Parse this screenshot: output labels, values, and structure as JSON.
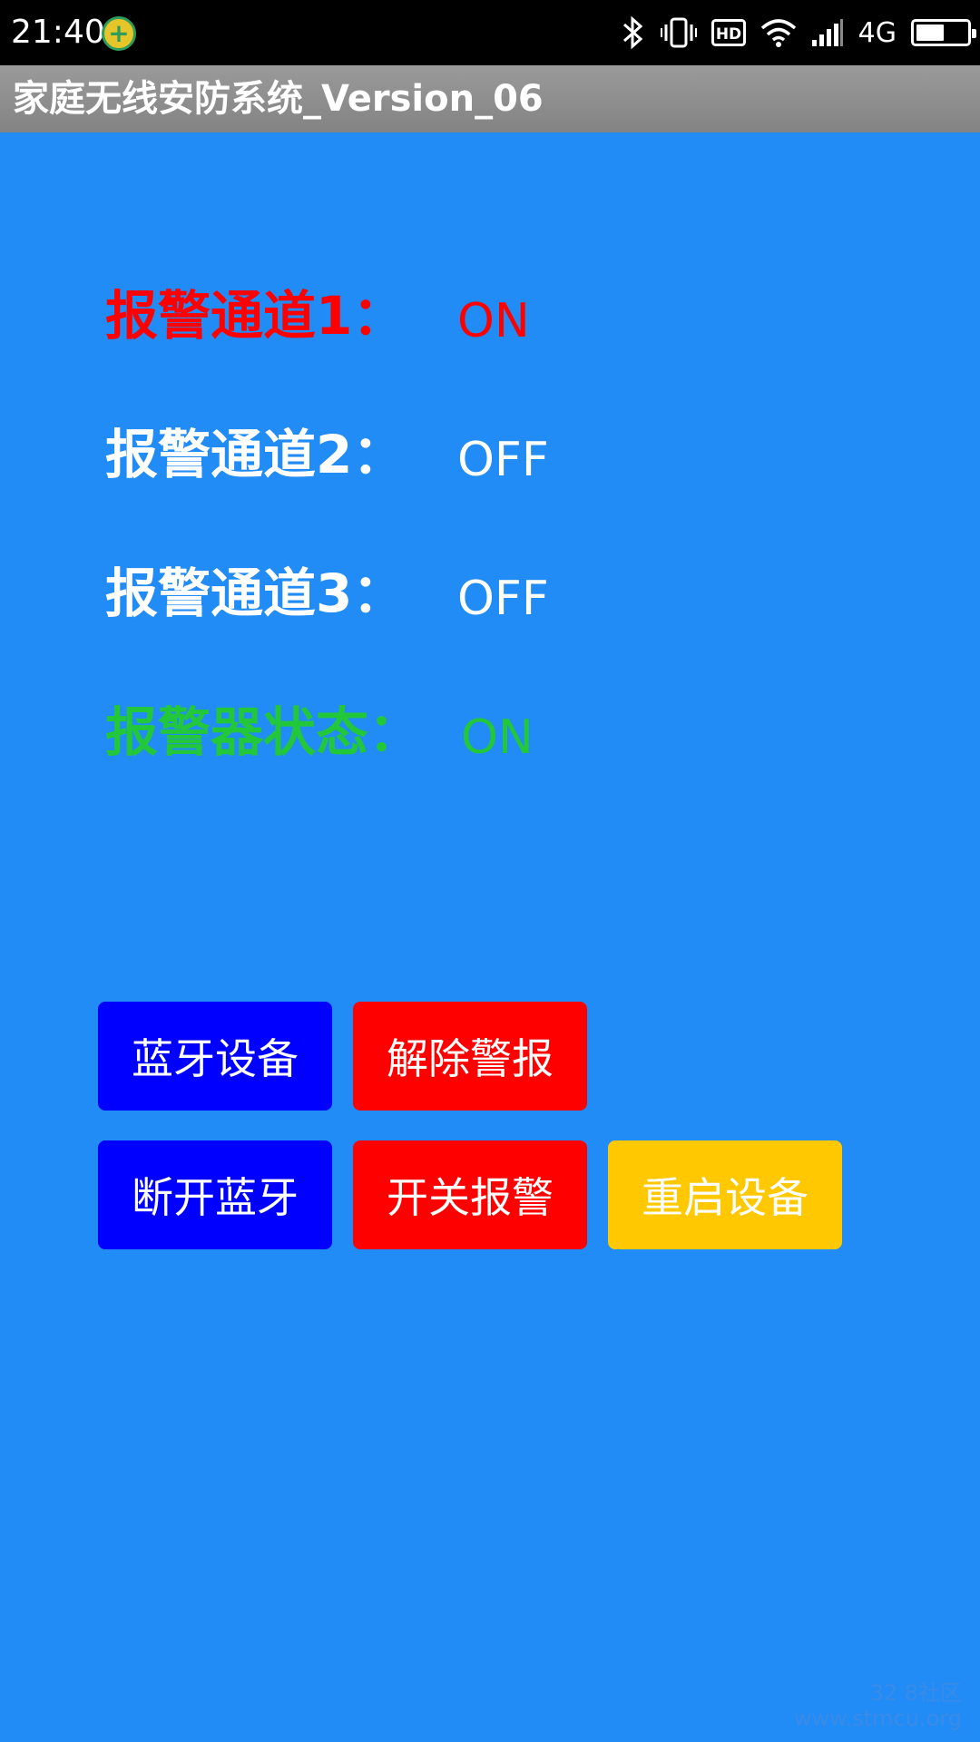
{
  "status_bar": {
    "time": "21:40",
    "network": "4G",
    "hd_label": "HD",
    "battery_level": 0.55
  },
  "app": {
    "title": "家庭无线安防系统_Version_06"
  },
  "alarms": [
    {
      "label": "报警通道1：",
      "value": "ON",
      "color": "#ff0000"
    },
    {
      "label": "报警通道2：",
      "value": "OFF",
      "color": "#ffffff"
    },
    {
      "label": "报警通道3：",
      "value": "OFF",
      "color": "#ffffff"
    },
    {
      "label": "报警器状态：",
      "value": "ON",
      "color": "#22c83a"
    }
  ],
  "buttons": {
    "bluetooth_device": {
      "label": "蓝牙设备",
      "color": "#0000ff"
    },
    "clear_alarm": {
      "label": "解除警报",
      "color": "#ff0000"
    },
    "disconnect_bluetooth": {
      "label": "断开蓝牙",
      "color": "#0000ff"
    },
    "toggle_alarm": {
      "label": "开关报警",
      "color": "#ff0000"
    },
    "restart_device": {
      "label": "重启设备",
      "color": "#ffc800"
    }
  },
  "colors": {
    "background": "#218bf6",
    "title_bar": "#8f8f8f"
  },
  "watermark": {
    "line1": "32 8社区",
    "line2": "www.stmcu.org"
  }
}
